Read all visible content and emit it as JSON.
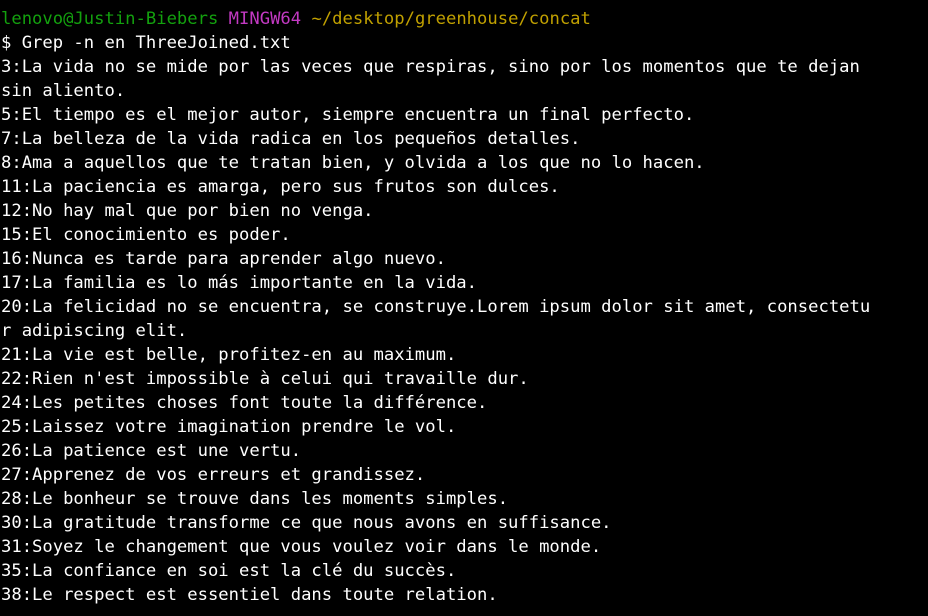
{
  "prompt": {
    "user_host": "lenovo@Justin-Biebers",
    "system": "MINGW64",
    "path": "~/desktop/greenhouse/concat"
  },
  "command": "$ Grep -n en ThreeJoined.txt",
  "output": [
    "3:La vida no se mide por las veces que respiras, sino por los momentos que te dejan",
    "sin aliento.",
    "5:El tiempo es el mejor autor, siempre encuentra un final perfecto.",
    "7:La belleza de la vida radica en los pequeños detalles.",
    "8:Ama a aquellos que te tratan bien, y olvida a los que no lo hacen.",
    "11:La paciencia es amarga, pero sus frutos son dulces.",
    "12:No hay mal que por bien no venga.",
    "15:El conocimiento es poder.",
    "16:Nunca es tarde para aprender algo nuevo.",
    "17:La familia es lo más importante en la vida.",
    "20:La felicidad no se encuentra, se construye.Lorem ipsum dolor sit amet, consectetu",
    "r adipiscing elit.",
    "21:La vie est belle, profitez-en au maximum.",
    "22:Rien n'est impossible à celui qui travaille dur.",
    "24:Les petites choses font toute la différence.",
    "25:Laissez votre imagination prendre le vol.",
    "26:La patience est une vertu.",
    "27:Apprenez de vos erreurs et grandissez.",
    "28:Le bonheur se trouve dans les moments simples.",
    "30:La gratitude transforme ce que nous avons en suffisance.",
    "31:Soyez le changement que vous voulez voir dans le monde.",
    "35:La confiance en soi est la clé du succès.",
    "38:Le respect est essentiel dans toute relation."
  ],
  "colors": {
    "background": "#000000",
    "text": "#ffffff",
    "user_host": "#13a10e",
    "system": "#c239c2",
    "path": "#c0a000"
  }
}
